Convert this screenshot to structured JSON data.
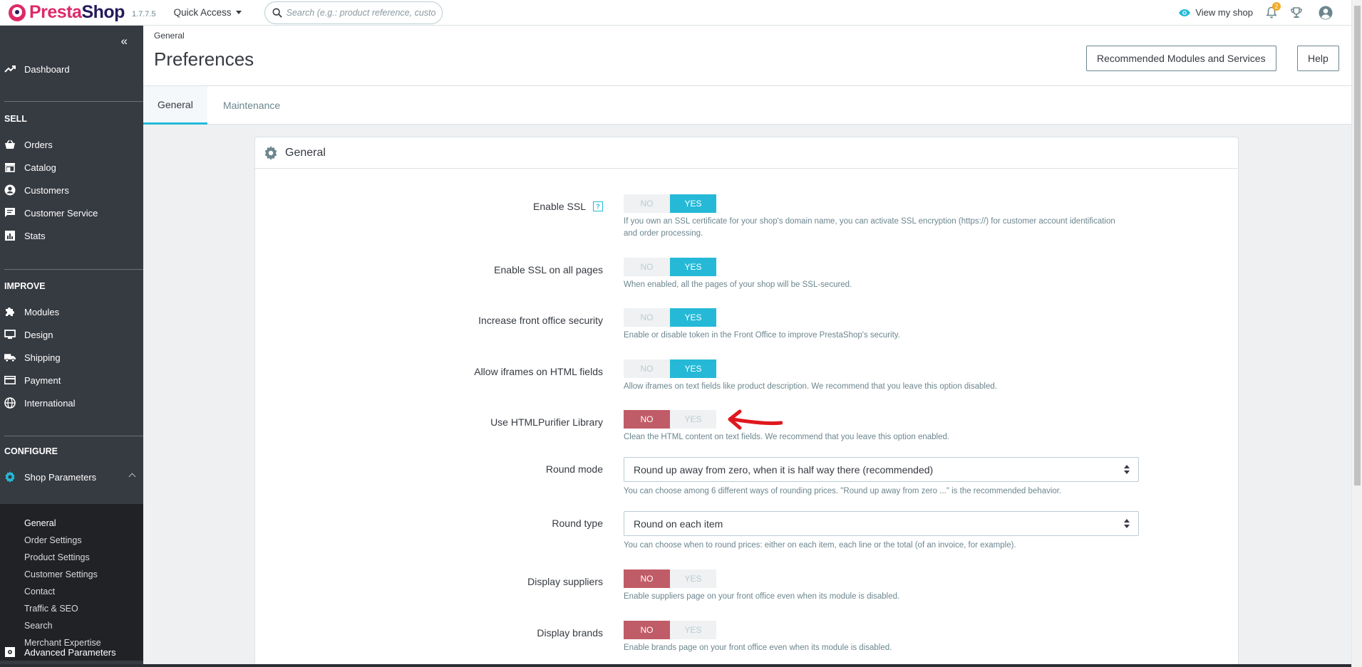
{
  "header": {
    "logo_main": "Presta",
    "logo_bold": "Shop",
    "version": "1.7.7.5",
    "quick_access": "Quick Access",
    "search_placeholder": "Search (e.g.: product reference, custome",
    "view_shop": "View my shop",
    "notifications_count": "2"
  },
  "sidebar": {
    "dashboard": "Dashboard",
    "sell_title": "SELL",
    "sell_items": [
      "Orders",
      "Catalog",
      "Customers",
      "Customer Service",
      "Stats"
    ],
    "improve_title": "IMPROVE",
    "improve_items": [
      "Modules",
      "Design",
      "Shipping",
      "Payment",
      "International"
    ],
    "configure_title": "CONFIGURE",
    "shop_parameters": "Shop Parameters",
    "shop_parameters_sub": [
      "General",
      "Order Settings",
      "Product Settings",
      "Customer Settings",
      "Contact",
      "Traffic & SEO",
      "Search",
      "Merchant Expertise"
    ],
    "advanced_parameters": "Advanced Parameters"
  },
  "page": {
    "breadcrumb": "General",
    "title": "Preferences",
    "btn_recommended": "Recommended Modules and Services",
    "btn_help": "Help",
    "tabs": [
      "General",
      "Maintenance"
    ]
  },
  "panel": {
    "title": "General",
    "switch_no": "NO",
    "switch_yes": "YES",
    "rows": [
      {
        "label": "Enable SSL",
        "value": "YES",
        "help": "If you own an SSL certificate for your shop's domain name, you can activate SSL encryption (https://) for customer account identification and order processing."
      },
      {
        "label": "Enable SSL on all pages",
        "value": "YES",
        "help": "When enabled, all the pages of your shop will be SSL-secured."
      },
      {
        "label": "Increase front office security",
        "value": "YES",
        "help": "Enable or disable token in the Front Office to improve PrestaShop's security."
      },
      {
        "label": "Allow iframes on HTML fields",
        "value": "YES",
        "help": "Allow iframes on text fields like product description. We recommend that you leave this option disabled."
      },
      {
        "label": "Use HTMLPurifier Library",
        "value": "NO",
        "help": "Clean the HTML content on text fields. We recommend that you leave this option enabled."
      },
      {
        "label": "Round mode",
        "select": "Round up away from zero, when it is half way there (recommended)",
        "help": "You can choose among 6 different ways of rounding prices. \"Round up away from zero ...\" is the recommended behavior."
      },
      {
        "label": "Round type",
        "select": "Round on each item",
        "help": "You can choose when to round prices: either on each item, each line or the total (of an invoice, for example)."
      },
      {
        "label": "Display suppliers",
        "value": "NO",
        "help": "Enable suppliers page on your front office even when its module is disabled."
      },
      {
        "label": "Display brands",
        "value": "NO",
        "help": "Enable brands page on your front office even when its module is disabled."
      }
    ]
  },
  "colors": {
    "accent": "#25b9d7",
    "danger": "#c05c67",
    "brand": "#dd2968",
    "sidebar": "#363a41",
    "annotation": "#e0181d"
  }
}
